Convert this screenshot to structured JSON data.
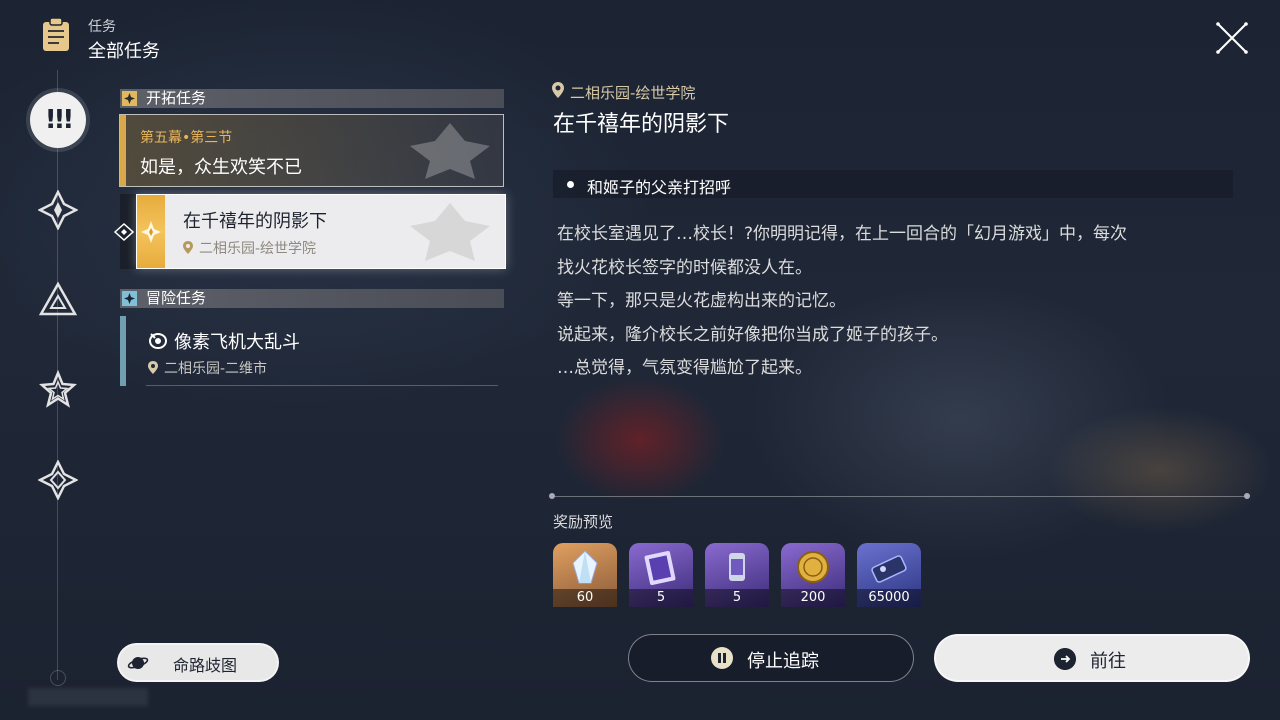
{
  "header": {
    "small_label": "任务",
    "title": "全部任务",
    "icon": "clipboard-icon",
    "close_icon": "close-icon"
  },
  "side_nav": {
    "active_icon": "exclamation-icon",
    "active_glyph": "!!!",
    "items": [
      "trailblaze-icon",
      "companion-icon",
      "adventure-icon",
      "daily-icon"
    ]
  },
  "sections": {
    "trailblaze": {
      "label": "开拓任务",
      "quests": [
        {
          "chapter": "第五幕•第三节",
          "title": "如是，众生欢笑不已"
        },
        {
          "title": "在千禧年的阴影下",
          "location": "二相乐园-绘世学院"
        }
      ]
    },
    "adventure": {
      "label": "冒险任务",
      "quests": [
        {
          "title": "像素飞机大乱斗",
          "location": "二相乐园-二维市"
        }
      ]
    }
  },
  "route_button": {
    "label": "命路歧图",
    "icon": "planet-icon"
  },
  "detail": {
    "location": "二相乐园-绘世学院",
    "title": "在千禧年的阴影下",
    "objective": "和姬子的父亲打招呼",
    "description": [
      "在校长室遇见了…校长！?你明明记得，在上一回合的「幻月游戏」中，每次",
      "找火花校长签字的时候都没人在。",
      "等一下，那只是火花虚构出来的记忆。",
      "说起来，隆介校长之前好像把你当成了姬子的孩子。",
      "…总觉得，气氛变得尴尬了起来。"
    ]
  },
  "rewards": {
    "title": "奖励预览",
    "items": [
      {
        "icon": "stellar-jade-icon",
        "count": "60",
        "color": "#c98a4a"
      },
      {
        "icon": "exp-book-icon",
        "count": "5",
        "color": "#6a4fb0"
      },
      {
        "icon": "refined-aether-icon",
        "count": "5",
        "color": "#6a4fb0"
      },
      {
        "icon": "coin-icon",
        "count": "200",
        "color": "#6a4fb0"
      },
      {
        "icon": "credit-icon",
        "count": "65000",
        "color": "#5a62b8"
      }
    ]
  },
  "buttons": {
    "stop": "停止追踪",
    "go": "前往"
  }
}
